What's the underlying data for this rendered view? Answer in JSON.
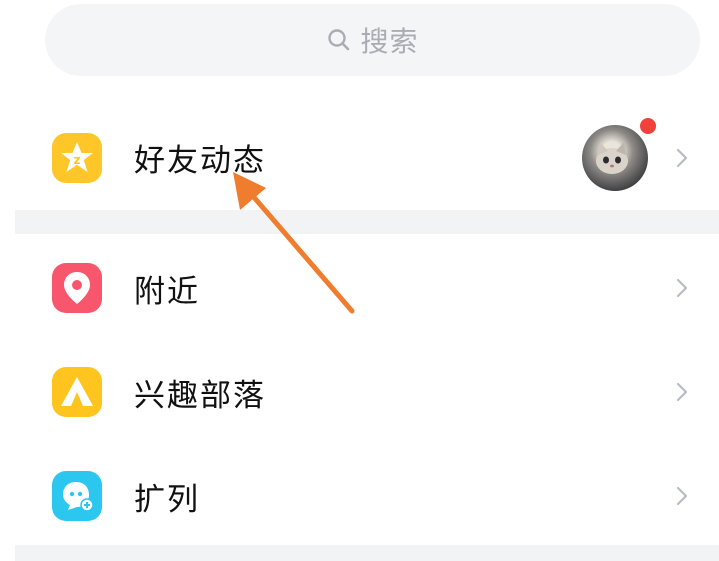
{
  "search": {
    "placeholder": "搜索",
    "icon": "search-icon"
  },
  "menu": {
    "items": [
      {
        "label": "好友动态",
        "icon": "qzone-star-icon",
        "color": "#ffc62a",
        "has_avatar": true,
        "has_badge_dot": true
      },
      {
        "label": "附近",
        "icon": "location-pin-icon",
        "color": "#f7566d"
      },
      {
        "label": "兴趣部落",
        "icon": "tent-icon",
        "color": "#ffc41d"
      },
      {
        "label": "扩列",
        "icon": "face-plus-icon",
        "color": "#2cc7ee"
      }
    ]
  },
  "colors": {
    "arrow": "#f07c2e",
    "badge_dot": "#f2403b",
    "chevron": "#b8bcc2"
  },
  "annotation": {
    "type": "arrow",
    "points_to": "好友动态"
  }
}
